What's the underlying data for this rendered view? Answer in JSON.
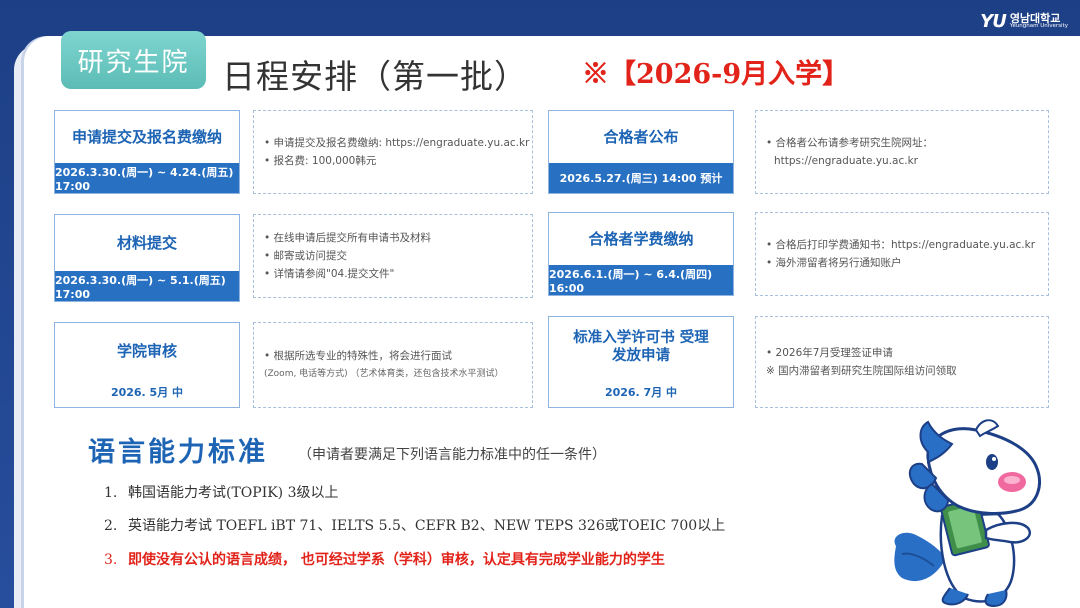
{
  "logo": {
    "mark": "YU",
    "ko": "영남대학교",
    "en": "Yeungnam University"
  },
  "badge": "研究生院",
  "title": "日程安排（第一批）",
  "subtitle": "※【2026-9月入学】",
  "steps": [
    {
      "title": "申请提交及报名费缴纳",
      "date": "2026.3.30.(周一) ~ 4.24.(周五) 17:00",
      "details": [
        "• 申请提交及报名费缴纳: https://engraduate.yu.ac.kr",
        "• 报名费: 100,000韩元"
      ]
    },
    {
      "title": "材料提交",
      "date": "2026.3.30.(周一) ~ 5.1.(周五) 17:00",
      "details": [
        "• 在线申请后提交所有申请书及材料",
        "• 邮寄或访问提交",
        "• 详情请参阅\"04.提交文件\""
      ]
    },
    {
      "title": "学院审核",
      "date": "2026. 5月 中",
      "details": [
        "• 根据所选专业的特殊性，将会进行面试",
        "(Zoom, 电话等方式) （艺术体育类，还包含技术水平测试）"
      ]
    },
    {
      "title": "合格者公布",
      "date": "2026.5.27.(周三) 14:00 预计",
      "details": [
        "• 合格者公布请参考研究生院网址：",
        "https://engraduate.yu.ac.kr"
      ]
    },
    {
      "title": "合格者学费缴纳",
      "date": "2026.6.1.(周一) ~ 6.4.(周四) 16:00",
      "details": [
        "• 合格后打印学费通知书：https://engraduate.yu.ac.kr",
        "• 海外滞留者将另行通知账户"
      ]
    },
    {
      "title": "标准入学许可书 受理发放申请",
      "date": "2026. 7月 中",
      "details": [
        "• 2026年7月受理签证申请",
        "※ 国内滞留者到研究生院国际组访问领取"
      ]
    }
  ],
  "language": {
    "title": "语言能力标准",
    "note": "（申请者要满足下列语言能力标准中的任一条件）",
    "items": [
      {
        "num": "1.",
        "text": "韩国语能力考试(TOPIK) 3级以上"
      },
      {
        "num": "2.",
        "text": "英语能力考试 TOEFL iBT 71、IELTS 5.5、CEFR B2、NEW TEPS 326或TOEIC 700以上"
      },
      {
        "num": "3.",
        "text": "即使没有公认的语言成绩，  也可经过学系（学科）审核，认定具有完成学业能力的学生"
      }
    ]
  }
}
